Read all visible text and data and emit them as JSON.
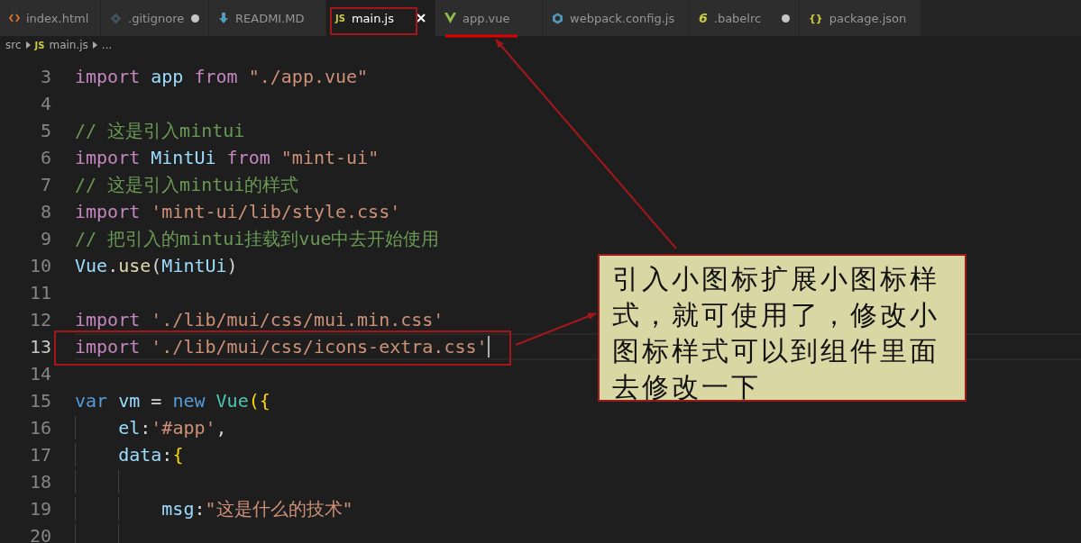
{
  "tabs": [
    {
      "label": "index.html",
      "kind": "html",
      "selected": false,
      "modified": false
    },
    {
      "label": ".gitignore",
      "kind": "git",
      "selected": false,
      "modified": true
    },
    {
      "label": "READMI.MD",
      "kind": "markdown",
      "selected": false,
      "modified": false
    },
    {
      "label": "main.js",
      "kind": "js",
      "icon_text": "JS",
      "selected": true,
      "modified": false
    },
    {
      "label": "app.vue",
      "kind": "vue",
      "selected": false,
      "modified": false
    },
    {
      "label": "webpack.config.js",
      "kind": "webpack",
      "selected": false,
      "modified": false
    },
    {
      "label": ".babelrc",
      "kind": "babel",
      "icon_text": "6",
      "selected": false,
      "modified": true
    },
    {
      "label": "package.json",
      "kind": "json",
      "icon_text": "{}",
      "selected": false,
      "modified": false
    }
  ],
  "breadcrumb": {
    "folder": "src",
    "file_icon_text": "JS",
    "file": "main.js",
    "more": "..."
  },
  "lines": [
    {
      "number": "3",
      "active": false,
      "tokens": [
        {
          "t": "import",
          "kind": "keyword"
        },
        {
          "t": " app",
          "kind": "variable"
        },
        {
          "t": " from",
          "kind": "keyword"
        },
        {
          "t": " \"./app.vue\"",
          "kind": "string"
        }
      ]
    },
    {
      "number": "4",
      "active": false
    },
    {
      "number": "5",
      "active": false,
      "tokens": [
        {
          "t": "// 这是引入mintui",
          "kind": "comment"
        }
      ]
    },
    {
      "number": "6",
      "active": false,
      "tokens": [
        {
          "t": "import",
          "kind": "keyword"
        },
        {
          "t": " MintUi",
          "kind": "variable"
        },
        {
          "t": " from",
          "kind": "keyword"
        },
        {
          "t": " \"mint-ui\"",
          "kind": "string"
        }
      ]
    },
    {
      "number": "7",
      "active": false,
      "tokens": [
        {
          "t": "// 这是引入mintui的样式",
          "kind": "comment"
        }
      ]
    },
    {
      "number": "8",
      "active": false,
      "tokens": [
        {
          "t": "import",
          "kind": "keyword"
        },
        {
          "t": " 'mint-ui/lib/style.css'",
          "kind": "string"
        }
      ]
    },
    {
      "number": "9",
      "active": false,
      "tokens": [
        {
          "t": "// 把引入的mintui挂载到vue中去开始使用",
          "kind": "comment"
        }
      ]
    },
    {
      "number": "10",
      "active": false,
      "tokens": [
        {
          "t": "Vue",
          "kind": "variable"
        },
        {
          "t": ".",
          "kind": "plain"
        },
        {
          "t": "use",
          "kind": "function"
        },
        {
          "t": "(",
          "kind": "plain"
        },
        {
          "t": "MintUi",
          "kind": "variable"
        },
        {
          "t": ")",
          "kind": "plain"
        }
      ]
    },
    {
      "number": "11",
      "active": false
    },
    {
      "number": "12",
      "active": false,
      "tokens": [
        {
          "t": "import",
          "kind": "keyword"
        },
        {
          "t": " './lib/mui/css/mui.min.css'",
          "kind": "string"
        }
      ]
    },
    {
      "number": "13",
      "active": true,
      "tokens": [
        {
          "t": "import",
          "kind": "keyword"
        },
        {
          "t": " './lib/mui/css/icons-extra.css'",
          "kind": "string"
        }
      ]
    },
    {
      "number": "14",
      "active": false
    },
    {
      "number": "15",
      "active": false,
      "tokens": [
        {
          "t": "var",
          "kind": "storage"
        },
        {
          "t": " vm",
          "kind": "variable"
        },
        {
          "t": " =",
          "kind": "plain"
        },
        {
          "t": " new",
          "kind": "storage"
        },
        {
          "t": " Vue",
          "kind": "class"
        },
        {
          "t": "({",
          "kind": "bracket"
        }
      ]
    },
    {
      "number": "16",
      "active": false,
      "tokens": [
        {
          "t": "    el",
          "kind": "variable"
        },
        {
          "t": ":",
          "kind": "plain"
        },
        {
          "t": "'#app'",
          "kind": "string"
        },
        {
          "t": ",",
          "kind": "plain"
        }
      ]
    },
    {
      "number": "17",
      "active": false,
      "tokens": [
        {
          "t": "    data",
          "kind": "variable"
        },
        {
          "t": ":",
          "kind": "plain"
        },
        {
          "t": "{",
          "kind": "bracket"
        }
      ]
    },
    {
      "number": "18",
      "active": false
    },
    {
      "number": "19",
      "active": false,
      "tokens": [
        {
          "t": "        msg",
          "kind": "variable"
        },
        {
          "t": ":",
          "kind": "plain"
        },
        {
          "t": "\"这是什么的技术\"",
          "kind": "string"
        }
      ]
    },
    {
      "number": "20",
      "active": false
    }
  ],
  "annotation": {
    "text": "引入小图标扩展小图标样式，就可使用了，修改小图标样式可以到组件里面去修改一下"
  }
}
